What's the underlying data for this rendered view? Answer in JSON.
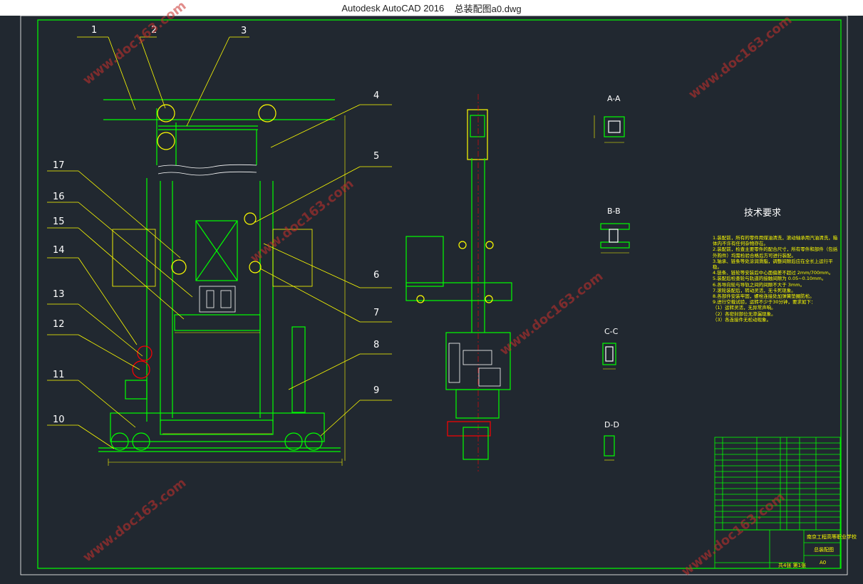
{
  "window": {
    "app": "Autodesk AutoCAD 2016",
    "file": "总装配图a0.dwg"
  },
  "callouts": [
    "1",
    "2",
    "3",
    "4",
    "5",
    "6",
    "7",
    "8",
    "9",
    "10",
    "11",
    "12",
    "13",
    "14",
    "15",
    "16",
    "17"
  ],
  "sections": {
    "aa": "A-A",
    "bb": "B-B",
    "cc": "C-C",
    "dd": "D-D"
  },
  "tech_requirements": {
    "title": "技术要求",
    "items": [
      "1.装配前，所有的零件用煤油清洗，滚动轴承用汽油清洗，箱体内不许有任何杂物存在。",
      "2.装配前，检查主要零件的配合尺寸，所有零件和部件（包括外购件）均需检验合格后方可进行装配。",
      "3.轴承、链条等处涂润滑脂，调整间隙后应在全长上运行平稳。",
      "4.链条、链轮等安装后中心面偏差不超过 2mm/700mm。",
      "5.装配后检查轮与轨道的接触间隙为 0.05~0.10mm。",
      "6.各导向轮与导轨之间的间隙不大于 3mm。",
      "7.滚轮装配后，转动灵活，无卡死现象。",
      "8.各部件安装牢固，螺栓连接处加弹簧垫圈防松。",
      "9.进行空载试验，运转不少于30分钟，要求如下：",
      "（1）运转灵活，无异常声响。",
      "（2）各密封部位无渗漏现象。",
      "（3）各连接件无松动现象。"
    ]
  },
  "title_block": {
    "school": "南京工程高等职业学校",
    "drawing_name": "总装配图",
    "sheet": "A0",
    "scale_row": "共4张 第1张"
  },
  "watermark": "www.doc163.com",
  "colors": {
    "background": "#212830",
    "frame": "#00ff00",
    "primary": "#00ff00",
    "dims": "#ffff00",
    "accent": "#ff0000",
    "text": "#ffffff"
  }
}
